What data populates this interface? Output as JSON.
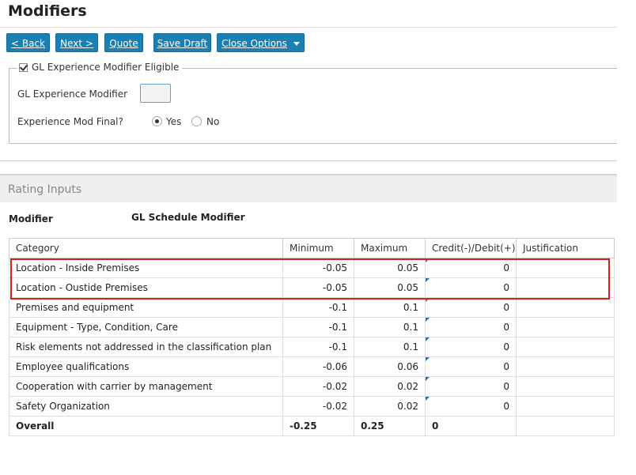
{
  "page": {
    "title": "Modifiers"
  },
  "toolbar": {
    "back_label": "< Back",
    "next_label": "Next >",
    "quote_label": "Quote",
    "save_draft_label": "Save Draft",
    "close_options_label": "Close Options"
  },
  "gl_section": {
    "eligible_label": "GL Experience Modifier Eligible",
    "eligible_checked": true,
    "modifier_label": "GL Experience Modifier",
    "modifier_value": "",
    "mod_final_label": "Experience Mod Final?",
    "mod_final_options": [
      "Yes",
      "No"
    ],
    "mod_final_selected": "Yes"
  },
  "rating": {
    "section_title": "Rating Inputs",
    "modifier_label": "Modifier",
    "modifier_value": "GL Schedule Modifier",
    "columns": [
      "Category",
      "Minimum",
      "Maximum",
      "Credit(-)/Debit(+)",
      "Justification"
    ],
    "rows": [
      {
        "category": "Location - Inside Premises",
        "min": "-0.05",
        "max": "0.05",
        "credit_debit": "0",
        "justification": ""
      },
      {
        "category": "Location - Oustide Premises",
        "min": "-0.05",
        "max": "0.05",
        "credit_debit": "0",
        "justification": ""
      },
      {
        "category": "Premises and equipment",
        "min": "-0.1",
        "max": "0.1",
        "credit_debit": "0",
        "justification": ""
      },
      {
        "category": "Equipment - Type, Condition, Care",
        "min": "-0.1",
        "max": "0.1",
        "credit_debit": "0",
        "justification": ""
      },
      {
        "category": "Risk elements not addressed in the classification plan",
        "min": "-0.1",
        "max": "0.1",
        "credit_debit": "0",
        "justification": ""
      },
      {
        "category": "Employee qualifications",
        "min": "-0.06",
        "max": "0.06",
        "credit_debit": "0",
        "justification": ""
      },
      {
        "category": "Cooperation with carrier by management",
        "min": "-0.02",
        "max": "0.02",
        "credit_debit": "0",
        "justification": ""
      },
      {
        "category": "Safety Organization",
        "min": "-0.02",
        "max": "0.02",
        "credit_debit": "0",
        "justification": ""
      }
    ],
    "overall": {
      "category": "Overall",
      "min": "-0.25",
      "max": "0.25",
      "credit_debit": "0",
      "justification": ""
    }
  },
  "colors": {
    "button": "#1a7fb3",
    "highlight": "#d9201f"
  }
}
